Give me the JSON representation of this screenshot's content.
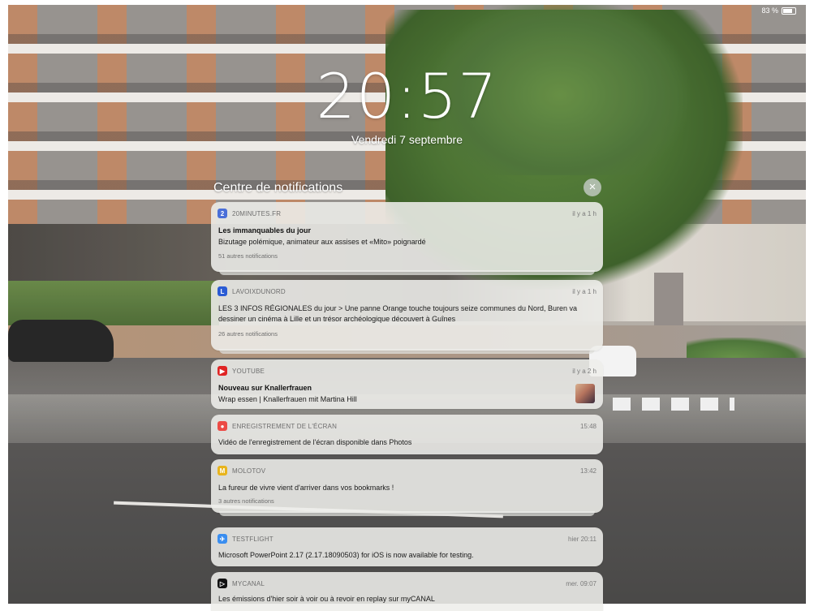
{
  "status_bar": {
    "battery_text": "83 %"
  },
  "lock_screen": {
    "time": "20:57",
    "date": "Vendredi 7 septembre"
  },
  "notification_center": {
    "title": "Centre de notifications",
    "close_icon": "close-icon",
    "notifications": [
      {
        "app": "20MINUTES.FR",
        "icon": "twenty-minutes-icon",
        "icon_color": "#4a6fd8",
        "time": "il y a 1 h",
        "title": "Les immanquables du jour",
        "body": "Bizutage polémique, animateur aux assises et «Mito» poignardé",
        "more": "51 autres notifications"
      },
      {
        "app": "LAVOIXDUNORD",
        "icon": "la-voix-du-nord-icon",
        "icon_color": "#2a5bd4",
        "time": "il y a 1 h",
        "title": "",
        "body": "LES 3 INFOS RÉGIONALES du jour > Une panne Orange touche toujours seize communes du Nord, Buren va dessiner un cinéma à Lille et un trésor archéologique découvert à Guînes",
        "more": "26 autres notifications"
      },
      {
        "app": "YOUTUBE",
        "icon": "youtube-icon",
        "icon_color": "#e02424",
        "time": "il y a 2 h",
        "title": "Nouveau sur Knallerfrauen",
        "body": "Wrap essen | Knallerfrauen mit Martina Hill",
        "more": ""
      },
      {
        "app": "ENREGISTREMENT DE L'ÉCRAN",
        "icon": "screen-recording-icon",
        "icon_color": "#ec4b45",
        "time": "15:48",
        "title": "",
        "body": "Vidéo de l'enregistrement de l'écran disponible dans Photos",
        "more": ""
      },
      {
        "app": "MOLOTOV",
        "icon": "molotov-icon",
        "icon_color": "#e8b41c",
        "time": "13:42",
        "title": "",
        "body": "La fureur de vivre vient d'arriver dans vos bookmarks !",
        "more": "3 autres notifications"
      },
      {
        "app": "TESTFLIGHT",
        "icon": "testflight-icon",
        "icon_color": "#3a8ef0",
        "time": "hier 20:11",
        "title": "",
        "body": "Microsoft PowerPoint 2.17 (2.17.18090503) for iOS is now available for testing.",
        "more": ""
      },
      {
        "app": "MYCANAL",
        "icon": "mycanal-icon",
        "icon_color": "#111111",
        "time": "mer. 09:07",
        "title": "",
        "body": "Les émissions d'hier soir à voir ou à revoir en replay sur myCANAL",
        "more": ""
      }
    ]
  }
}
